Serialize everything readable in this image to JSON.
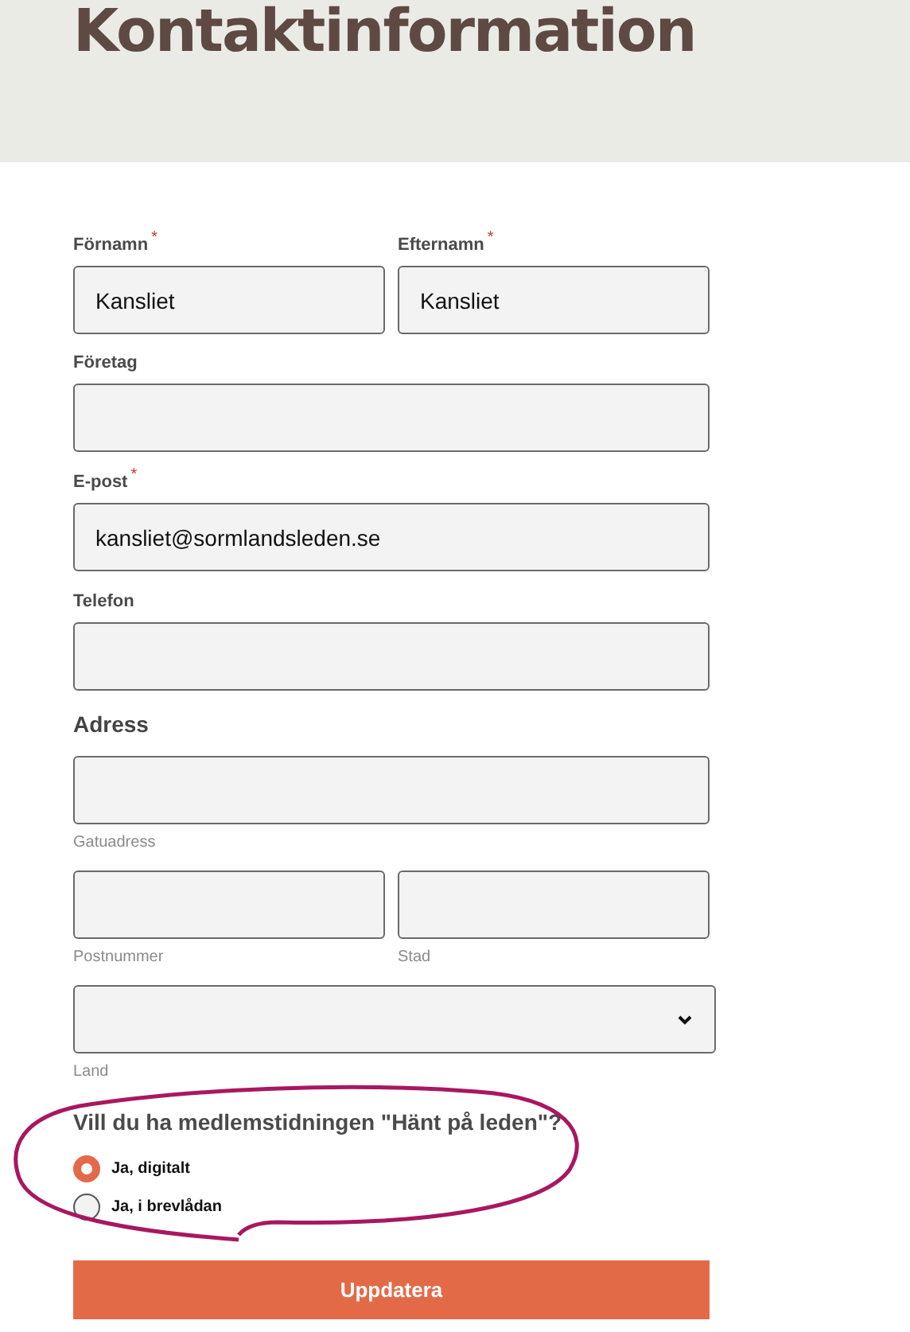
{
  "page_title": "Kontaktinformation",
  "name_row": [
    {
      "label": "Förnamn",
      "required_mark": "*",
      "value": "Kansliet"
    },
    {
      "label": "Efternamn",
      "required_mark": "*",
      "value": "Kansliet"
    }
  ],
  "company": {
    "label": "Företag"
  },
  "email": {
    "label": "E-post",
    "required_mark": "*",
    "value": "kansliet@sormlandsleden.se"
  },
  "phone": {
    "label": "Telefon"
  },
  "address": {
    "heading": "Adress",
    "street": {
      "caption": "Gatuadress"
    },
    "postal_row": [
      {
        "caption": "Postnummer"
      },
      {
        "caption": "Stad"
      }
    ],
    "country": {
      "caption": "Land"
    }
  },
  "newsletter": {
    "question": "Vill du ha medlemstidningen \"Hänt på leden\"?",
    "options": [
      {
        "label": "Ja, digitalt",
        "selected": true
      },
      {
        "label": "Ja, i brevlådan",
        "selected": false
      }
    ]
  },
  "submit": "Uppdatera"
}
